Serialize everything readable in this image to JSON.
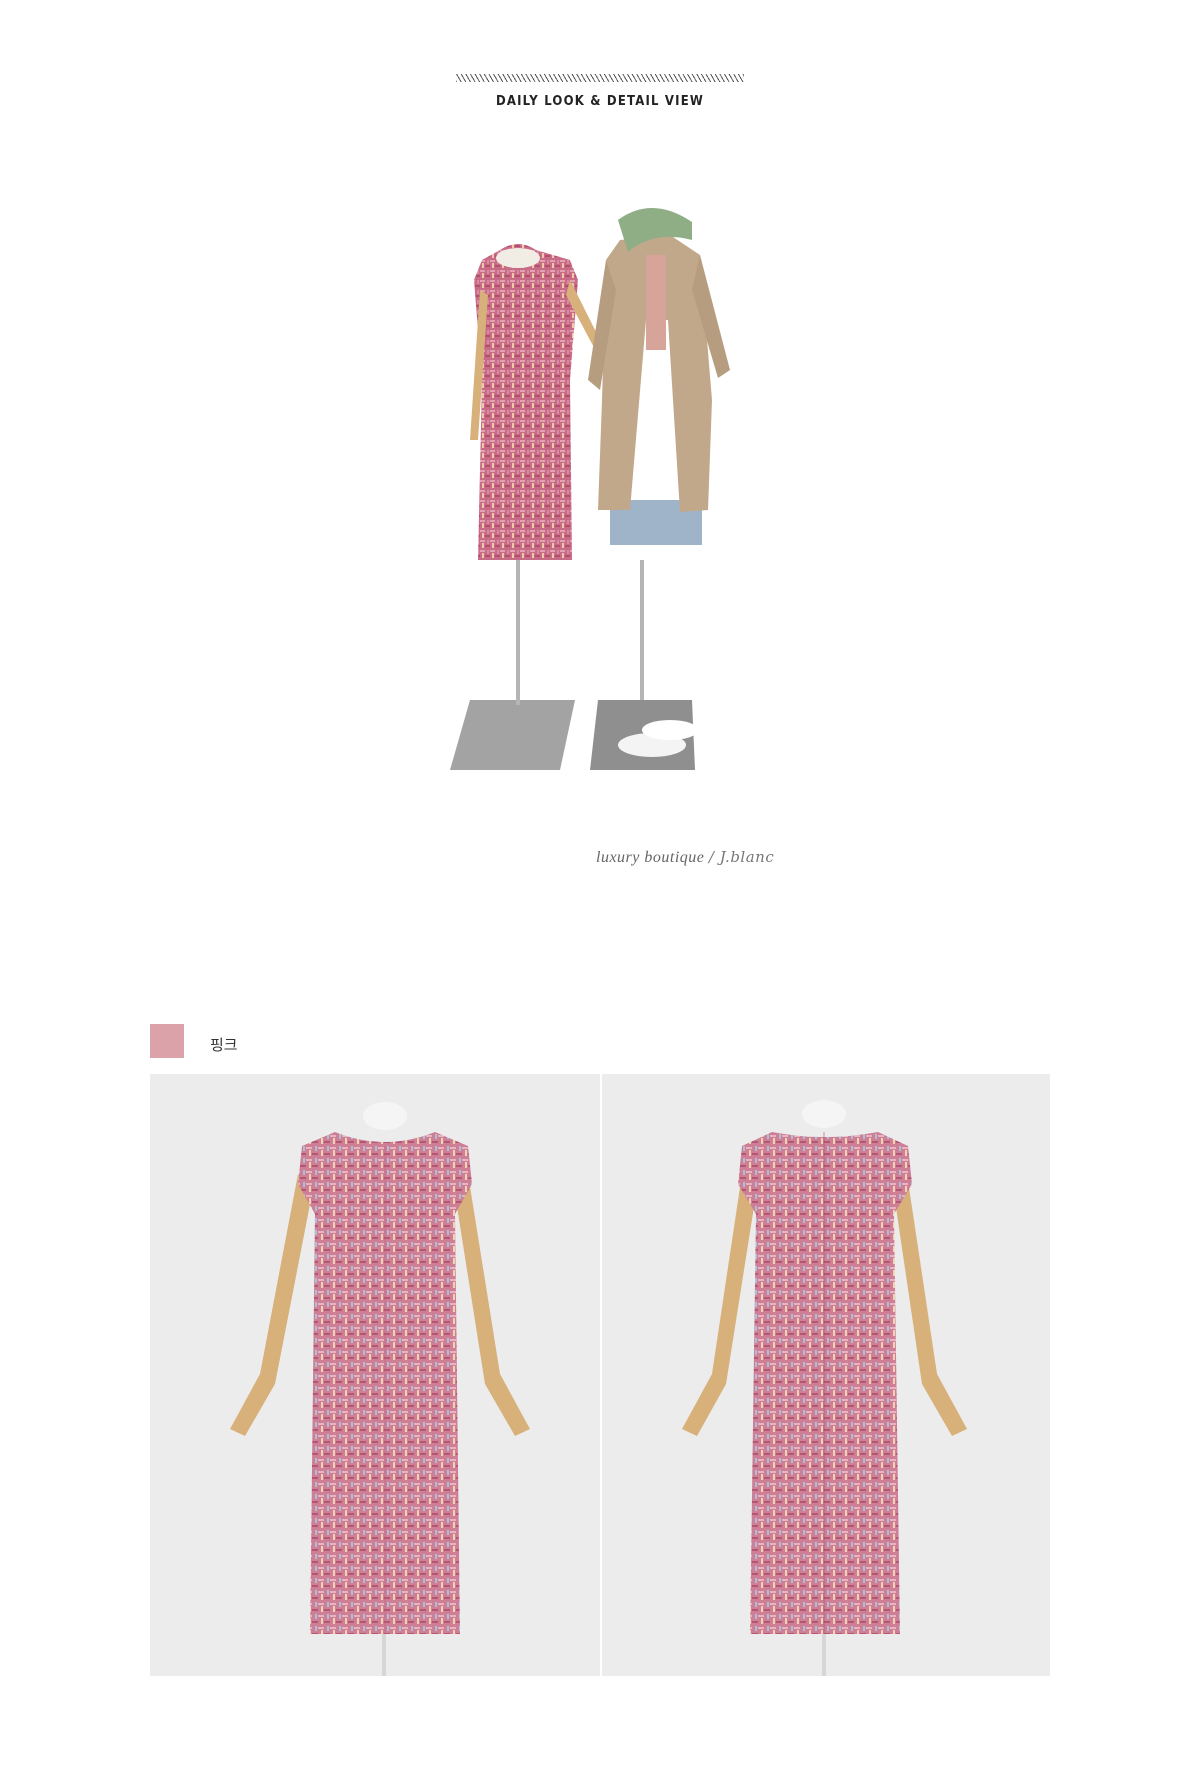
{
  "section": {
    "title": "DAILY LOOK & DETAIL VIEW"
  },
  "hero": {
    "tagline": "luxury boutique",
    "signature": "/ J.blanc"
  },
  "color_option": {
    "name": "핑크",
    "swatch_color": "#dba3a9"
  },
  "images": {
    "hero_icon": "mannequin-pair-image",
    "front_icon": "dress-front-image",
    "back_icon": "dress-back-image"
  },
  "colors": {
    "tweed_pink": "#c86b86",
    "tweed_light": "#d99aa8",
    "trench": "#c2a88a",
    "scarf": "#8fae86",
    "wood_arm": "#d7b07a",
    "stand": "#9c9c9c",
    "backdrop": "#ececec"
  }
}
